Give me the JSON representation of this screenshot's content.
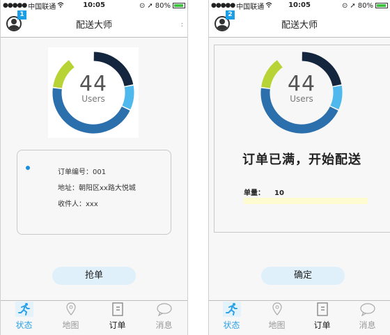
{
  "status_bar": {
    "carrier": "中国联通",
    "time": "10:05",
    "battery": "80%"
  },
  "app_title": "配送大师",
  "screens": [
    {
      "badge": "1"
    },
    {
      "badge": "2"
    }
  ],
  "donut": {
    "value": "44",
    "label": "Users",
    "segments": [
      {
        "color": "#14263d",
        "fraction": 0.22
      },
      {
        "color": "#4fb8ec",
        "fraction": 0.1
      },
      {
        "color": "#2b6fac",
        "fraction": 0.45
      },
      {
        "color": "#b8d336",
        "fraction": 0.13
      }
    ]
  },
  "order": {
    "number": "订单编号：001",
    "address": "地址：朝阳区xx路大悦城",
    "recipient": "收件人：xxx"
  },
  "grab_button": "抢单",
  "full": {
    "title": "订单已满，开始配送",
    "qty_label": "单量：",
    "qty_value": "10"
  },
  "confirm_button": "确定",
  "tabs": [
    {
      "label": "状态",
      "icon": "runner-icon"
    },
    {
      "label": "地图",
      "icon": "map-pin-icon"
    },
    {
      "label": "订单",
      "icon": "order-list-icon"
    },
    {
      "label": "消息",
      "icon": "chat-bubble-icon"
    }
  ],
  "colors": {
    "accent": "#2aa1e8",
    "badge": "#1a9ee6",
    "button_bg": "#dff0fb",
    "battery": "#3cc23c"
  }
}
